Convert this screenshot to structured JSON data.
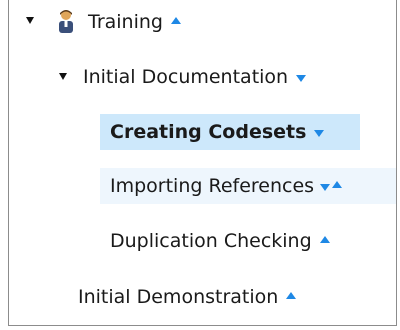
{
  "tree": {
    "items": [
      {
        "label": "Training",
        "icon": "person-icon"
      },
      {
        "label": "Initial Documentation"
      },
      {
        "label": "Creating Codesets"
      },
      {
        "label": "Importing References"
      },
      {
        "label": "Duplication Checking"
      },
      {
        "label": "Initial Demonstration"
      }
    ]
  },
  "colors": {
    "accent": "#1e88e5",
    "selected_bg": "#cde8fb",
    "hover_bg": "#eef6fd"
  }
}
